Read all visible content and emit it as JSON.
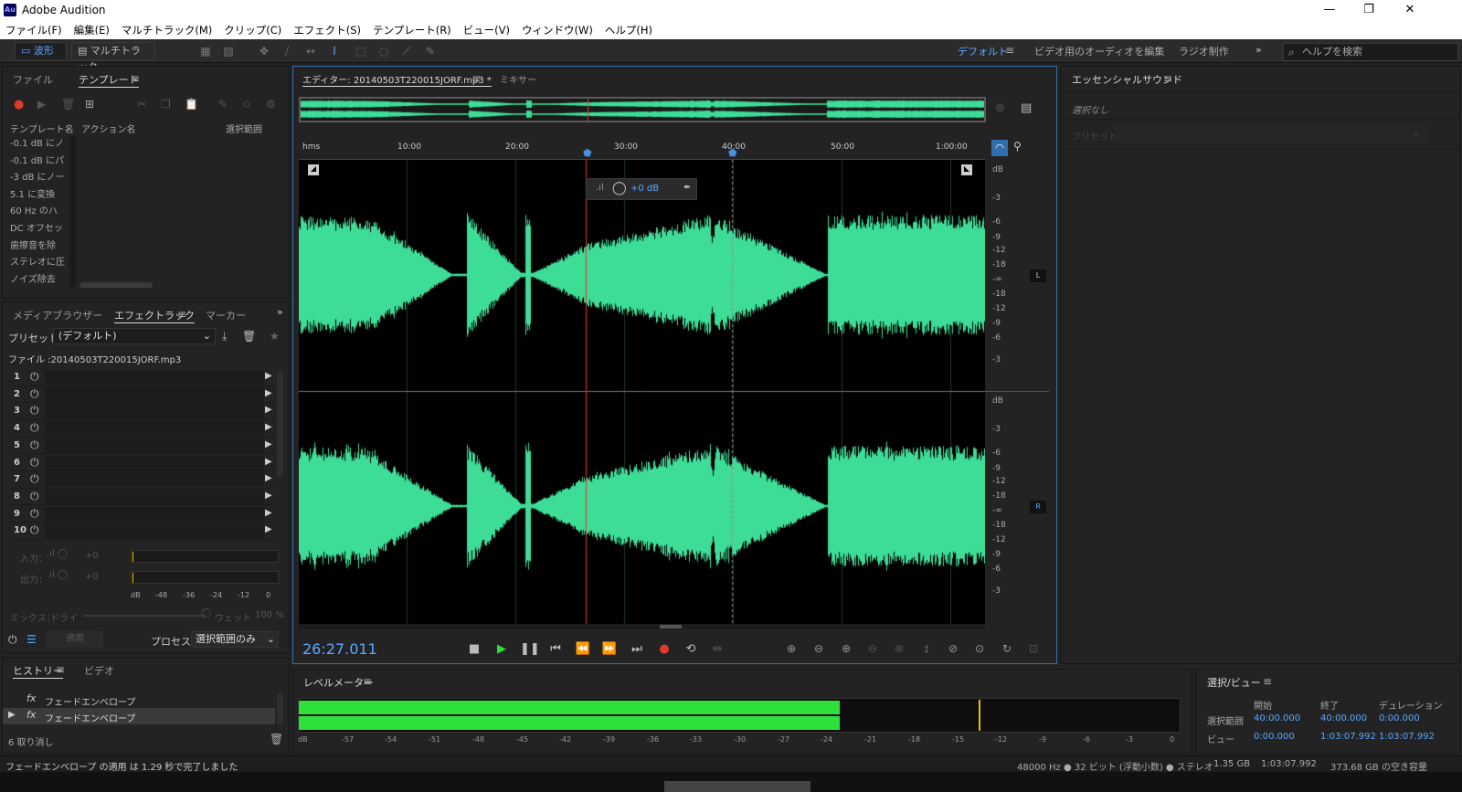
{
  "app": {
    "name": "Adobe Audition",
    "logo": "Au"
  },
  "menu": [
    "ファイル(F)",
    "編集(E)",
    "マルチトラック(M)",
    "クリップ(C)",
    "エフェクト(S)",
    "テンプレート(R)",
    "ビュー(V)",
    "ウィンドウ(W)",
    "ヘルプ(H)"
  ],
  "toolbar": {
    "waveform": "波形",
    "multitrack": "マルチトラック"
  },
  "workspaces": {
    "default": "デフォルト",
    "video": "ビデオ用のオーディオを編集",
    "radio": "ラジオ制作"
  },
  "search": {
    "placeholder": "ヘルプを検索"
  },
  "files_panel": {
    "tabs": [
      "ファイル",
      "テンプレート"
    ],
    "columns": [
      "テンプレート名",
      "アクション名",
      "選択範囲"
    ],
    "items": [
      "-0.1 dB にノ",
      "-0.1 dB にパ",
      "-3 dB にノー",
      "5.1 に変換",
      "60 Hz のハ",
      "DC オフセッ",
      "歯擦音を除",
      "ステレオに圧",
      "ノイズ除去"
    ]
  },
  "effects_panel": {
    "tabs": [
      "メディアブラウザー",
      "エフェクトラック",
      "マーカー"
    ],
    "preset_label": "プリセット：",
    "preset_value": "(デフォルト)",
    "file_label": "ファイル :20140503T220015JORF.mp3",
    "slots": [
      "1",
      "2",
      "3",
      "4",
      "5",
      "6",
      "7",
      "8",
      "9",
      "10"
    ],
    "input_label": "入力：",
    "output_label": "出力：",
    "io_value": "+0",
    "meter_ticks": [
      "dB",
      "-48",
      "-36",
      "-24",
      "-12",
      "0"
    ],
    "mix_label": "ミックス：",
    "dry": "ドライ",
    "wet": "ウェット",
    "wet_value": "100 %",
    "apply": "適用",
    "process_label": "プロセス：",
    "process_value": "選択範囲のみ"
  },
  "history_panel": {
    "tabs": [
      "ヒストリー",
      "ビデオ"
    ],
    "items": [
      "フェードエンベロープ",
      "フェードエンベロープ"
    ],
    "undo": "6 取り消し"
  },
  "editor": {
    "tabs": [
      "エディター: 20140503T220015JORF.mp3 *",
      "ミキサー"
    ],
    "ruler": [
      "hms",
      "10:00",
      "20:00",
      "30:00",
      "40:00",
      "50:00",
      "1:00:00"
    ],
    "hud_value": "+0 dB",
    "db_scale": [
      "dB",
      "-3",
      "-6",
      "-9",
      "-12",
      "-18",
      "-∞",
      "-18",
      "-12",
      "-9",
      "-6",
      "-3"
    ],
    "channel_l": "L",
    "channel_r": "R",
    "time": "26:27.011",
    "waveform_color": "#3ddc97",
    "playhead_color": "#e03a2a"
  },
  "essential_sound": {
    "title": "エッセンシャルサウンド",
    "none": "選択なし",
    "preset_label": "プリセット："
  },
  "level_meter": {
    "title": "レベルメーター",
    "ticks": [
      "dB",
      "-57",
      "-54",
      "-51",
      "-48",
      "-45",
      "-42",
      "-39",
      "-36",
      "-33",
      "-30",
      "-27",
      "-24",
      "-21",
      "-18",
      "-15",
      "-12",
      "-9",
      "-6",
      "-3",
      "0"
    ],
    "level_fraction": 0.614,
    "peak_fraction": 0.772,
    "color": "#2ee03a"
  },
  "selection_view": {
    "title": "選択/ビュー",
    "headers": [
      "開始",
      "終了",
      "デュレーション"
    ],
    "rows": [
      {
        "label": "選択範囲",
        "start": "40:00.000",
        "end": "40:00.000",
        "duration": "0:00.000"
      },
      {
        "label": "ビュー",
        "start": "0:00.000",
        "end": "1:03:07.992",
        "duration": "1:03:07.992"
      }
    ]
  },
  "status": {
    "message": "フェードエンベロープ の適用 は 1.29 秒で完了しました",
    "format": "48000 Hz ● 32 ビット (浮動小数) ● ステレオ",
    "size": "1.35 GB",
    "duration": "1:03:07.992",
    "free": "373.68 GB の空き容量"
  }
}
